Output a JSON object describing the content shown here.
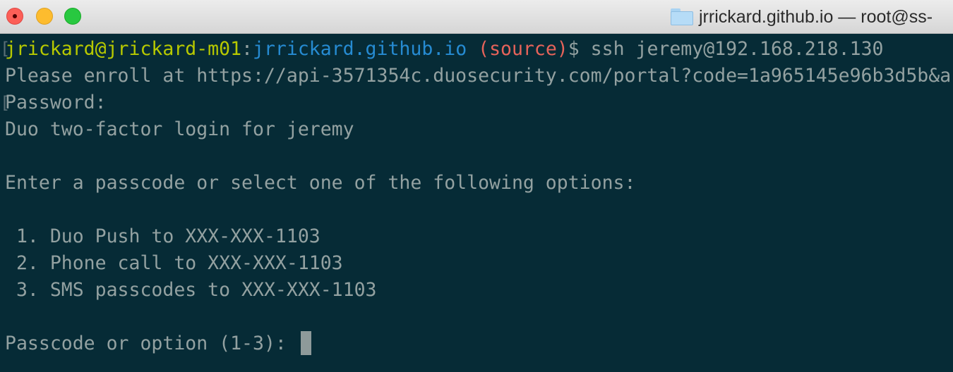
{
  "window": {
    "title": "jrrickard.github.io — root@ss-",
    "icon": "folder-icon"
  },
  "prompt": {
    "user_host": "jrickard@jrickard-m01",
    "separator": ":",
    "path": "jrrickard.github.io",
    "branch": " (source)",
    "symbol": "$ ",
    "command": "ssh jeremy@192.168.218.130"
  },
  "output": {
    "enroll": "Please enroll at https://api-3571354c.duosecurity.com/portal?code=1a965145e96b3d5b&a",
    "password": "Password:",
    "duo_login": "Duo two-factor login for jeremy",
    "enter_passcode": "Enter a passcode or select one of the following options:",
    "options": [
      " 1. Duo Push to XXX-XXX-1103",
      " 2. Phone call to XXX-XXX-1103",
      " 3. SMS passcodes to XXX-XXX-1103"
    ],
    "input_prompt": "Passcode or option (1-3): "
  },
  "colors": {
    "background": "#062b36",
    "text": "#93a1a1",
    "user_host": "#b7c900",
    "path": "#268bd2",
    "branch": "#e6635a"
  }
}
